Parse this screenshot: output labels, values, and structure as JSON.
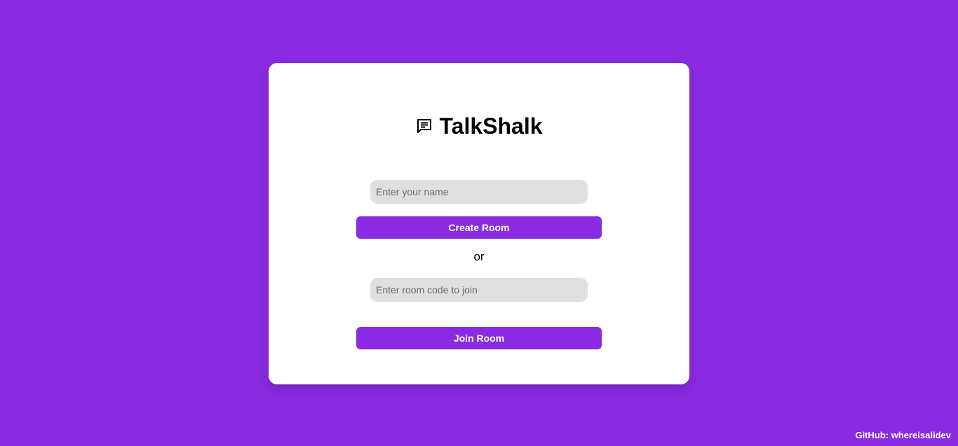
{
  "app": {
    "title": "TalkShalk",
    "icon": "chat-message-icon"
  },
  "form": {
    "name_placeholder": "Enter your name",
    "create_label": "Create Room",
    "or_text": "or",
    "room_code_placeholder": "Enter room code to join",
    "join_label": "Join Room"
  },
  "footer": {
    "github_text": "GitHub: whereisalidev"
  },
  "colors": {
    "background": "#8a2be2",
    "accent": "#8a2be2",
    "card": "#ffffff",
    "input_bg": "#e0dfdf"
  }
}
